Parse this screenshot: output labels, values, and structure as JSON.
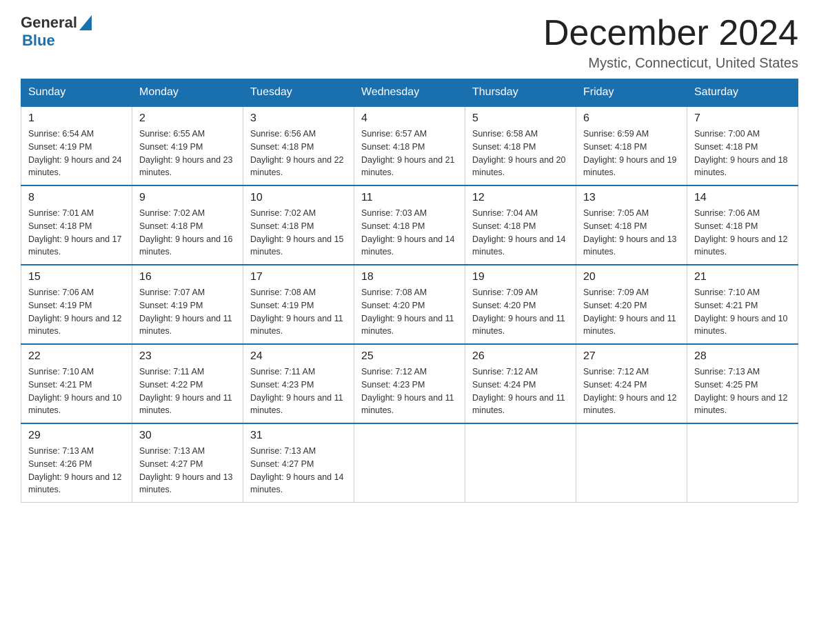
{
  "header": {
    "logo": {
      "general": "General",
      "blue": "Blue",
      "tagline": "GeneralBlue"
    },
    "title": "December 2024",
    "location": "Mystic, Connecticut, United States"
  },
  "calendar": {
    "days_of_week": [
      "Sunday",
      "Monday",
      "Tuesday",
      "Wednesday",
      "Thursday",
      "Friday",
      "Saturday"
    ],
    "weeks": [
      [
        {
          "day": "1",
          "sunrise": "6:54 AM",
          "sunset": "4:19 PM",
          "daylight": "9 hours and 24 minutes."
        },
        {
          "day": "2",
          "sunrise": "6:55 AM",
          "sunset": "4:19 PM",
          "daylight": "9 hours and 23 minutes."
        },
        {
          "day": "3",
          "sunrise": "6:56 AM",
          "sunset": "4:18 PM",
          "daylight": "9 hours and 22 minutes."
        },
        {
          "day": "4",
          "sunrise": "6:57 AM",
          "sunset": "4:18 PM",
          "daylight": "9 hours and 21 minutes."
        },
        {
          "day": "5",
          "sunrise": "6:58 AM",
          "sunset": "4:18 PM",
          "daylight": "9 hours and 20 minutes."
        },
        {
          "day": "6",
          "sunrise": "6:59 AM",
          "sunset": "4:18 PM",
          "daylight": "9 hours and 19 minutes."
        },
        {
          "day": "7",
          "sunrise": "7:00 AM",
          "sunset": "4:18 PM",
          "daylight": "9 hours and 18 minutes."
        }
      ],
      [
        {
          "day": "8",
          "sunrise": "7:01 AM",
          "sunset": "4:18 PM",
          "daylight": "9 hours and 17 minutes."
        },
        {
          "day": "9",
          "sunrise": "7:02 AM",
          "sunset": "4:18 PM",
          "daylight": "9 hours and 16 minutes."
        },
        {
          "day": "10",
          "sunrise": "7:02 AM",
          "sunset": "4:18 PM",
          "daylight": "9 hours and 15 minutes."
        },
        {
          "day": "11",
          "sunrise": "7:03 AM",
          "sunset": "4:18 PM",
          "daylight": "9 hours and 14 minutes."
        },
        {
          "day": "12",
          "sunrise": "7:04 AM",
          "sunset": "4:18 PM",
          "daylight": "9 hours and 14 minutes."
        },
        {
          "day": "13",
          "sunrise": "7:05 AM",
          "sunset": "4:18 PM",
          "daylight": "9 hours and 13 minutes."
        },
        {
          "day": "14",
          "sunrise": "7:06 AM",
          "sunset": "4:18 PM",
          "daylight": "9 hours and 12 minutes."
        }
      ],
      [
        {
          "day": "15",
          "sunrise": "7:06 AM",
          "sunset": "4:19 PM",
          "daylight": "9 hours and 12 minutes."
        },
        {
          "day": "16",
          "sunrise": "7:07 AM",
          "sunset": "4:19 PM",
          "daylight": "9 hours and 11 minutes."
        },
        {
          "day": "17",
          "sunrise": "7:08 AM",
          "sunset": "4:19 PM",
          "daylight": "9 hours and 11 minutes."
        },
        {
          "day": "18",
          "sunrise": "7:08 AM",
          "sunset": "4:20 PM",
          "daylight": "9 hours and 11 minutes."
        },
        {
          "day": "19",
          "sunrise": "7:09 AM",
          "sunset": "4:20 PM",
          "daylight": "9 hours and 11 minutes."
        },
        {
          "day": "20",
          "sunrise": "7:09 AM",
          "sunset": "4:20 PM",
          "daylight": "9 hours and 11 minutes."
        },
        {
          "day": "21",
          "sunrise": "7:10 AM",
          "sunset": "4:21 PM",
          "daylight": "9 hours and 10 minutes."
        }
      ],
      [
        {
          "day": "22",
          "sunrise": "7:10 AM",
          "sunset": "4:21 PM",
          "daylight": "9 hours and 10 minutes."
        },
        {
          "day": "23",
          "sunrise": "7:11 AM",
          "sunset": "4:22 PM",
          "daylight": "9 hours and 11 minutes."
        },
        {
          "day": "24",
          "sunrise": "7:11 AM",
          "sunset": "4:23 PM",
          "daylight": "9 hours and 11 minutes."
        },
        {
          "day": "25",
          "sunrise": "7:12 AM",
          "sunset": "4:23 PM",
          "daylight": "9 hours and 11 minutes."
        },
        {
          "day": "26",
          "sunrise": "7:12 AM",
          "sunset": "4:24 PM",
          "daylight": "9 hours and 11 minutes."
        },
        {
          "day": "27",
          "sunrise": "7:12 AM",
          "sunset": "4:24 PM",
          "daylight": "9 hours and 12 minutes."
        },
        {
          "day": "28",
          "sunrise": "7:13 AM",
          "sunset": "4:25 PM",
          "daylight": "9 hours and 12 minutes."
        }
      ],
      [
        {
          "day": "29",
          "sunrise": "7:13 AM",
          "sunset": "4:26 PM",
          "daylight": "9 hours and 12 minutes."
        },
        {
          "day": "30",
          "sunrise": "7:13 AM",
          "sunset": "4:27 PM",
          "daylight": "9 hours and 13 minutes."
        },
        {
          "day": "31",
          "sunrise": "7:13 AM",
          "sunset": "4:27 PM",
          "daylight": "9 hours and 14 minutes."
        },
        null,
        null,
        null,
        null
      ]
    ]
  }
}
